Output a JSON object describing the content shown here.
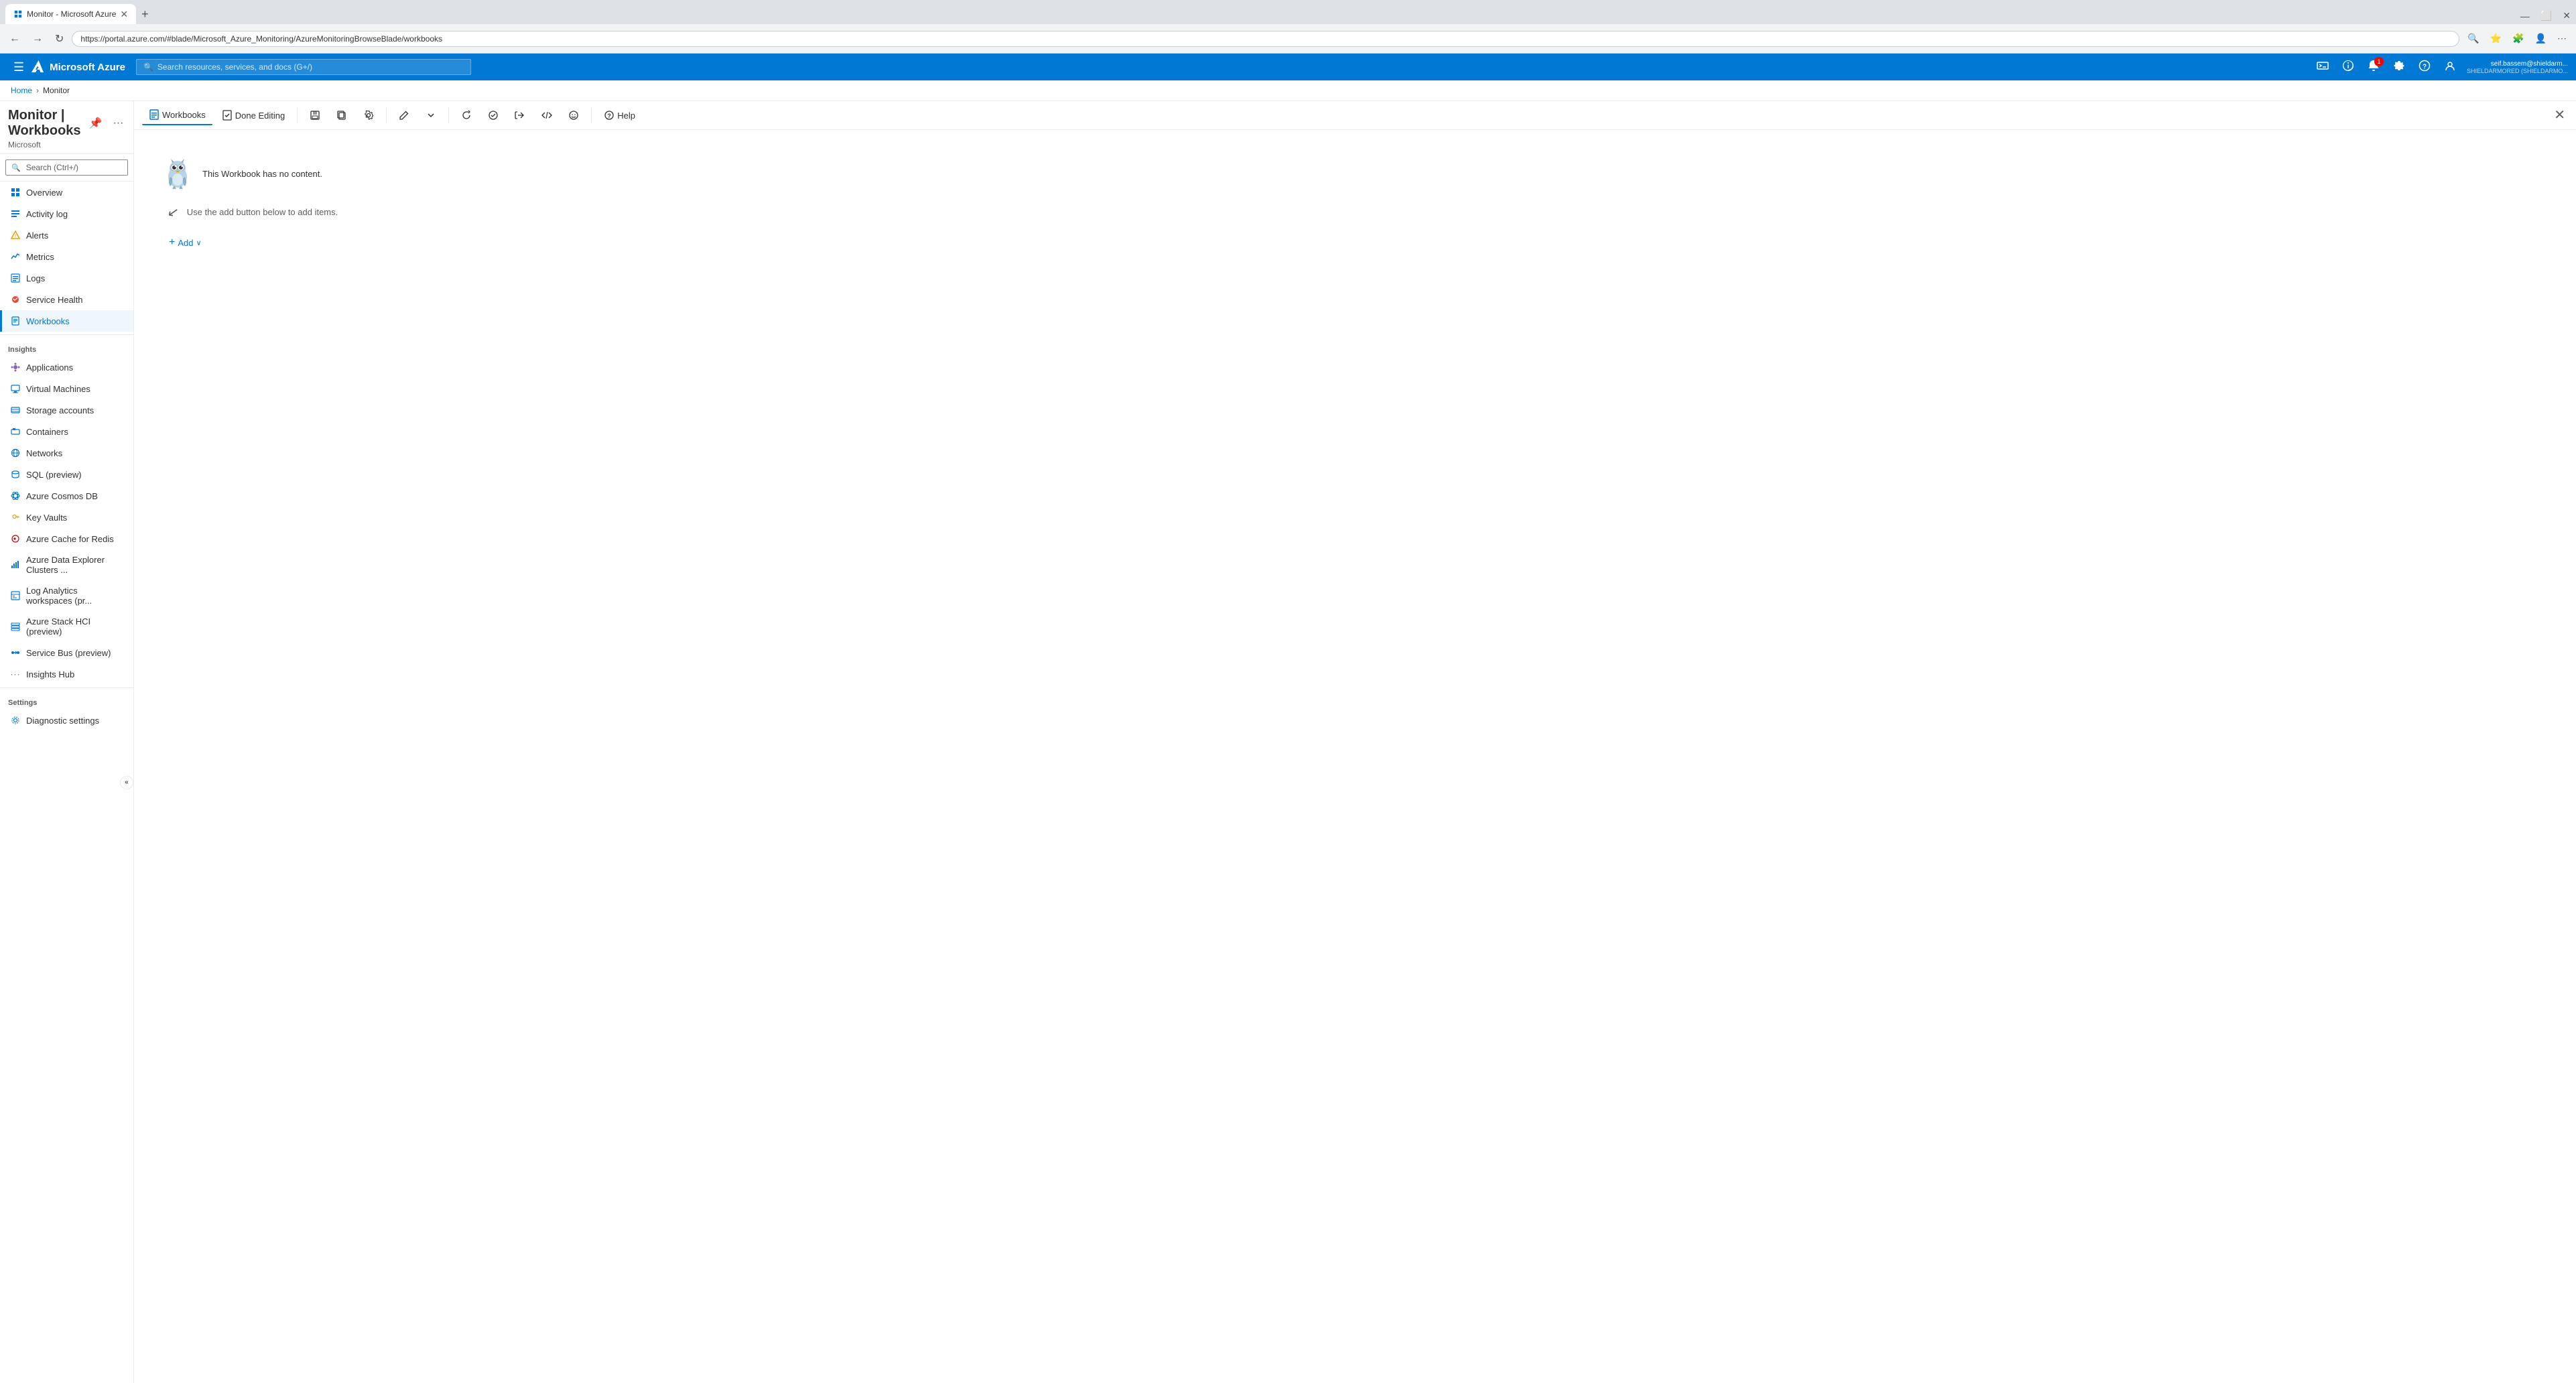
{
  "browser": {
    "tab_title": "Monitor - Microsoft Azure",
    "tab_favicon": "A",
    "url": "https://portal.azure.com/#blade/Microsoft_Azure_Monitoring/AzureMonitoringBrowseBlade/workbooks",
    "new_tab_label": "+",
    "back_btn": "←",
    "forward_btn": "→",
    "refresh_btn": "↻",
    "window_minimize": "—",
    "window_maximize": "⬜",
    "window_close": "✕"
  },
  "azure_header": {
    "hamburger": "☰",
    "logo_text": "Microsoft Azure",
    "search_placeholder": "Search resources, services, and docs (G+/)",
    "icons": [
      "portal",
      "notifications",
      "settings",
      "help",
      "feedback"
    ],
    "notification_badge": "1",
    "user_name": "seif.bassem@shieldarm...",
    "user_org": "SHIELDARMORED (SHIELDARMO..."
  },
  "breadcrumb": {
    "home": "Home",
    "current": "Monitor"
  },
  "page": {
    "title": "Monitor | Workbooks",
    "subtitle": "Microsoft",
    "pin_icon": "📌",
    "more_icon": "..."
  },
  "sidebar": {
    "search_placeholder": "Search (Ctrl+/)",
    "collapse_icon": "«",
    "items": [
      {
        "id": "overview",
        "label": "Overview",
        "icon": "⬡"
      },
      {
        "id": "activity-log",
        "label": "Activity log",
        "icon": "≡"
      },
      {
        "id": "alerts",
        "label": "Alerts",
        "icon": "🔔"
      },
      {
        "id": "metrics",
        "label": "Metrics",
        "icon": "📈"
      },
      {
        "id": "logs",
        "label": "Logs",
        "icon": "📄"
      },
      {
        "id": "service-health",
        "label": "Service Health",
        "icon": "❤"
      },
      {
        "id": "workbooks",
        "label": "Workbooks",
        "icon": "📓",
        "active": true
      }
    ],
    "insights_section": "Insights",
    "insights_items": [
      {
        "id": "applications",
        "label": "Applications",
        "icon": "◆"
      },
      {
        "id": "virtual-machines",
        "label": "Virtual Machines",
        "icon": "💻"
      },
      {
        "id": "storage-accounts",
        "label": "Storage accounts",
        "icon": "🗄"
      },
      {
        "id": "containers",
        "label": "Containers",
        "icon": "📦"
      },
      {
        "id": "networks",
        "label": "Networks",
        "icon": "🌐"
      },
      {
        "id": "sql-preview",
        "label": "SQL (preview)",
        "icon": "🗃"
      },
      {
        "id": "cosmos-db",
        "label": "Azure Cosmos DB",
        "icon": "⚙"
      },
      {
        "id": "key-vaults",
        "label": "Key Vaults",
        "icon": "🔑"
      },
      {
        "id": "cache-redis",
        "label": "Azure Cache for Redis",
        "icon": "⚡"
      },
      {
        "id": "data-explorer",
        "label": "Azure Data Explorer Clusters ...",
        "icon": "📊"
      },
      {
        "id": "log-analytics",
        "label": "Log Analytics workspaces (pr...",
        "icon": "📋"
      },
      {
        "id": "stack-hci",
        "label": "Azure Stack HCI (preview)",
        "icon": "🖥"
      },
      {
        "id": "service-bus",
        "label": "Service Bus (preview)",
        "icon": "🚌"
      },
      {
        "id": "insights-hub",
        "label": "Insights Hub",
        "icon": "···"
      }
    ],
    "settings_section": "Settings",
    "settings_items": [
      {
        "id": "diagnostic-settings",
        "label": "Diagnostic settings",
        "icon": "⚙"
      }
    ]
  },
  "toolbar": {
    "workbooks_label": "Workbooks",
    "done_editing_label": "Done Editing",
    "save_icon": "💾",
    "copy_icon": "⧉",
    "settings_icon": "⚙",
    "edit_icon": "✏",
    "chevron_icon": "∨",
    "refresh_icon": "↻",
    "pin_icon": "📌",
    "link_icon": "🔗",
    "code_icon": "</>",
    "emoji_icon": "☺",
    "help_label": "Help",
    "help_icon": "?"
  },
  "workbook": {
    "empty_message": "This Workbook has no content.",
    "hint_text": "Use the add button below to add items.",
    "add_label": "Add"
  }
}
